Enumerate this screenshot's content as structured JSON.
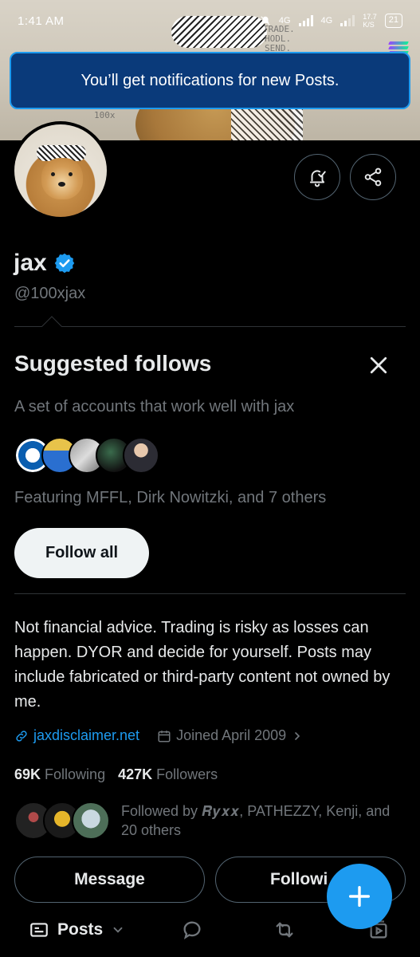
{
  "status_bar": {
    "time": "1:41 AM",
    "net1": "4G",
    "net2": "4G",
    "speed_top": "17.7",
    "speed_bottom": "K/S",
    "battery": "21"
  },
  "banner": {
    "doodle_top": "TRADE.",
    "doodle_mid": "HODL.",
    "doodle_bot": "SEND.",
    "doodle_100x": "100x"
  },
  "toast": {
    "message": "You’ll get notifications for new Posts."
  },
  "profile": {
    "name": "jax",
    "handle": "@100xjax",
    "verified": true,
    "verified_color": "#1d9bf0"
  },
  "suggested": {
    "title": "Suggested follows",
    "subtitle": "A set of accounts that work well with jax",
    "featuring": "Featuring MFFL, Dirk Nowitzki, and 7 others",
    "follow_all_label": "Follow all"
  },
  "bio": "Not financial advice. Trading is risky as losses can happen. DYOR and decide for yourself. Posts may include fabricated or third-party content not owned by me.",
  "meta": {
    "link": "jaxdisclaimer.net",
    "joined": "Joined April 2009"
  },
  "stats": {
    "following_count": "69K",
    "following_label": "Following",
    "followers_count": "427K",
    "followers_label": "Followers"
  },
  "followed_by": {
    "prefix": "Followed by",
    "names": "𝑹𝒚𝒙𝒙, PATHEZZY, Kenji, and 20 others"
  },
  "actions": {
    "message": "Message",
    "following": "Followi"
  },
  "tabbar": {
    "posts_label": "Posts"
  },
  "colors": {
    "accent": "#1d9bf0",
    "background": "#000000",
    "muted": "#71767b",
    "border": "#2f3336"
  }
}
